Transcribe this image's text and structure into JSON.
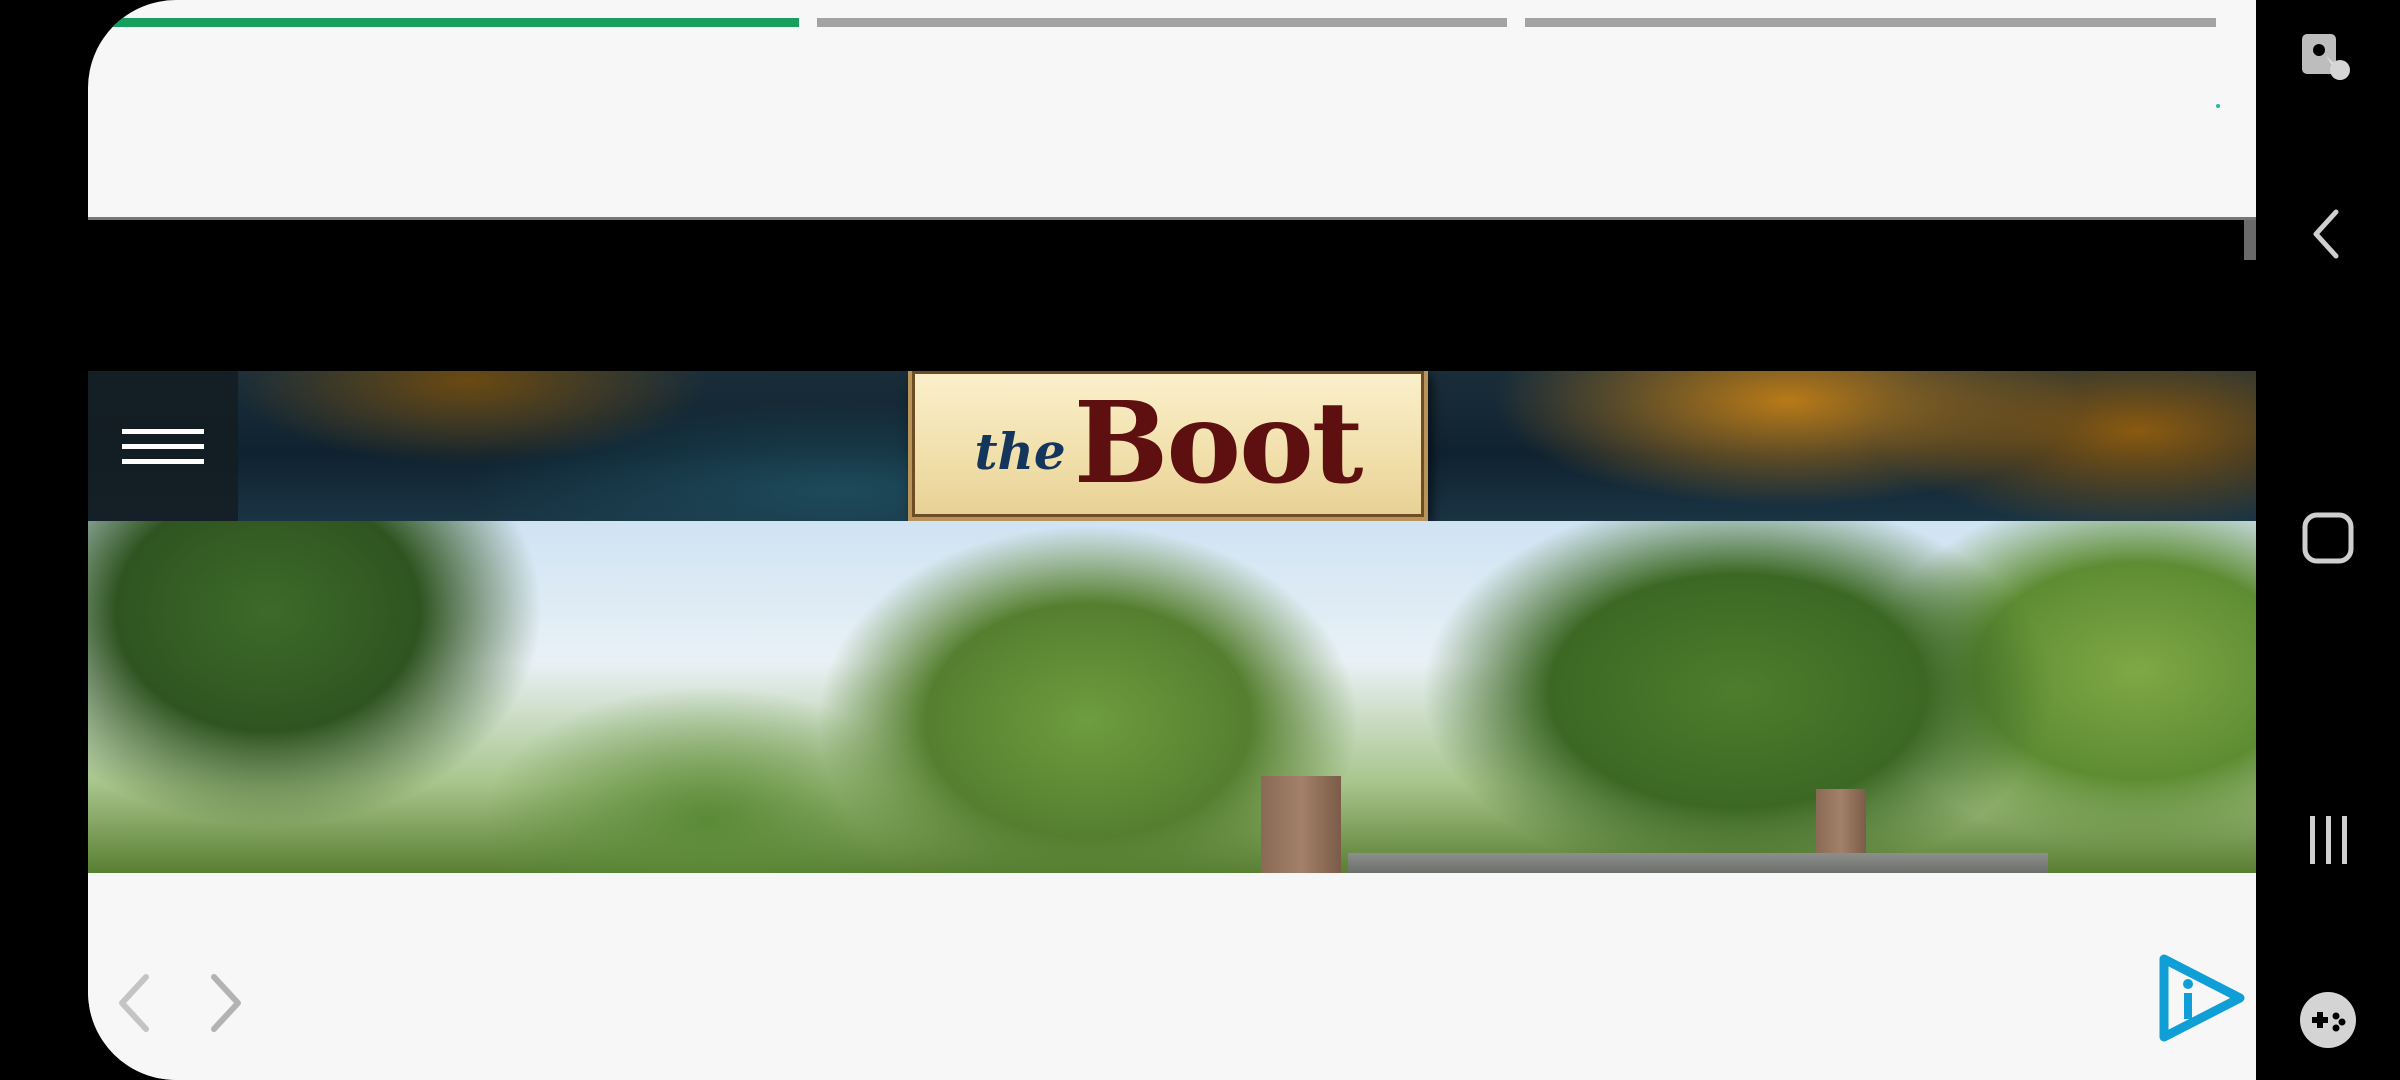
{
  "story": {
    "progress_segments": [
      {
        "state": "active",
        "fill": 1.0
      },
      {
        "state": "pending",
        "fill": 0.0
      },
      {
        "state": "pending",
        "fill": 0.0
      }
    ],
    "progress_active_color": "#17a05d",
    "progress_pending_color": "#a3a3a3"
  },
  "site_header": {
    "logo_prefix": "the",
    "logo_name": "Boot",
    "menu_icon": "hamburger-menu-icon"
  },
  "hero": {
    "image": "photo-trees-house-chimneys"
  },
  "bottom_bar": {
    "back_icon": "chevron-left-icon",
    "forward_icon": "chevron-right-icon",
    "brand_icon": "play-info-logo-icon",
    "brand_color": "#0f9fd6"
  },
  "system_nav": {
    "items": [
      "accessibility-icon",
      "back-icon",
      "home-icon",
      "recents-icon",
      "game-tools-icon"
    ]
  }
}
